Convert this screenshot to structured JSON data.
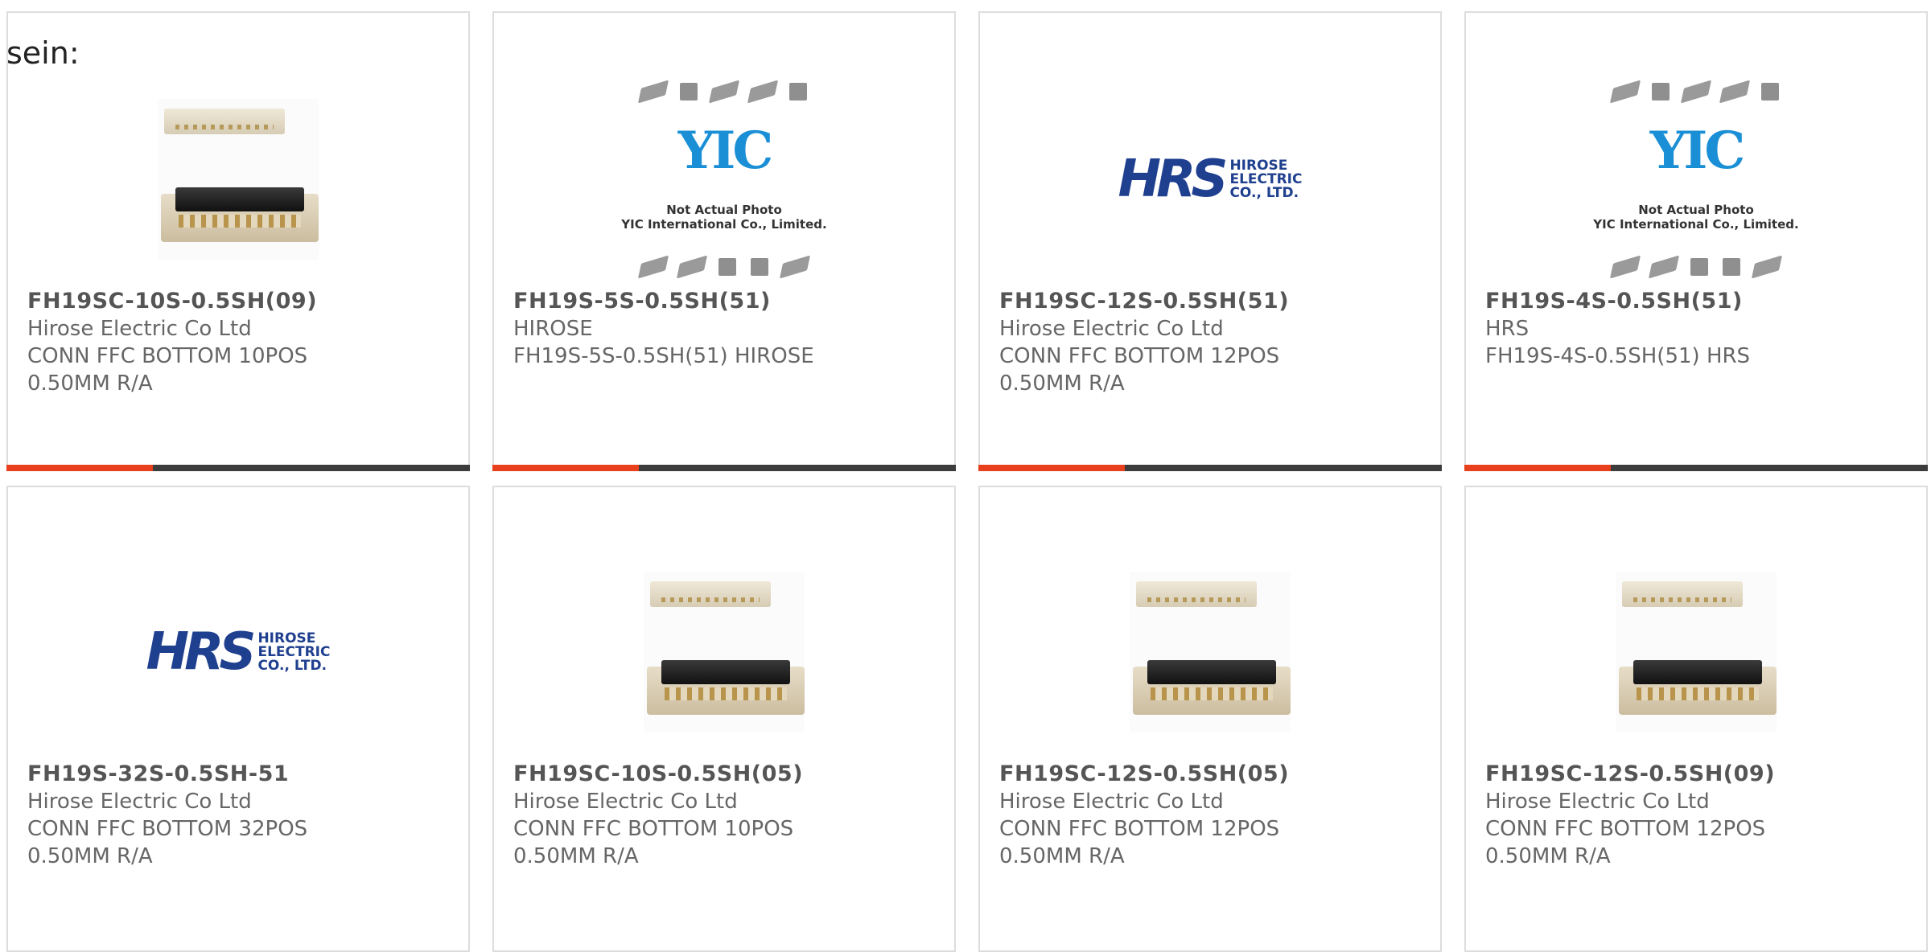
{
  "lead_text": "sein:",
  "colors": {
    "accent": "#e8401c",
    "bar": "#3c3c3c",
    "border": "#dddddd"
  },
  "products": [
    {
      "part": "FH19SC-10S-0.5SH(09)",
      "maker": "Hirose Electric Co Ltd",
      "desc1": "CONN FFC BOTTOM 10POS",
      "desc2": "0.50MM R/A",
      "image": "connector-photo"
    },
    {
      "part": "FH19S-5S-0.5SH(51)",
      "maker": "HIROSE",
      "desc1": "FH19S-5S-0.5SH(51) HIROSE",
      "desc2": "",
      "image": "yic-placeholder"
    },
    {
      "part": "FH19SC-12S-0.5SH(51)",
      "maker": "Hirose Electric Co Ltd",
      "desc1": "CONN FFC BOTTOM 12POS",
      "desc2": "0.50MM R/A",
      "image": "hrs-logo"
    },
    {
      "part": "FH19S-4S-0.5SH(51)",
      "maker": "HRS",
      "desc1": "FH19S-4S-0.5SH(51) HRS",
      "desc2": "",
      "image": "yic-placeholder"
    },
    {
      "part": "FH19S-32S-0.5SH-51",
      "maker": "Hirose Electric Co Ltd",
      "desc1": "CONN FFC BOTTOM 32POS",
      "desc2": "0.50MM R/A",
      "image": "hrs-logo"
    },
    {
      "part": "FH19SC-10S-0.5SH(05)",
      "maker": "Hirose Electric Co Ltd",
      "desc1": "CONN FFC BOTTOM 10POS",
      "desc2": "0.50MM R/A",
      "image": "connector-photo"
    },
    {
      "part": "FH19SC-12S-0.5SH(05)",
      "maker": "Hirose Electric Co Ltd",
      "desc1": "CONN FFC BOTTOM 12POS",
      "desc2": "0.50MM R/A",
      "image": "connector-photo"
    },
    {
      "part": "FH19SC-12S-0.5SH(09)",
      "maker": "Hirose Electric Co Ltd",
      "desc1": "CONN FFC BOTTOM 12POS",
      "desc2": "0.50MM R/A",
      "image": "connector-photo"
    }
  ],
  "placeholder": {
    "logo": "YIC",
    "caption1": "Not Actual Photo",
    "caption2": "YIC International Co., Limited."
  },
  "hrs_logo": {
    "mark": "HRS",
    "line1": "HIROSE",
    "line2": "ELECTRIC",
    "line3": "CO., LTD."
  }
}
